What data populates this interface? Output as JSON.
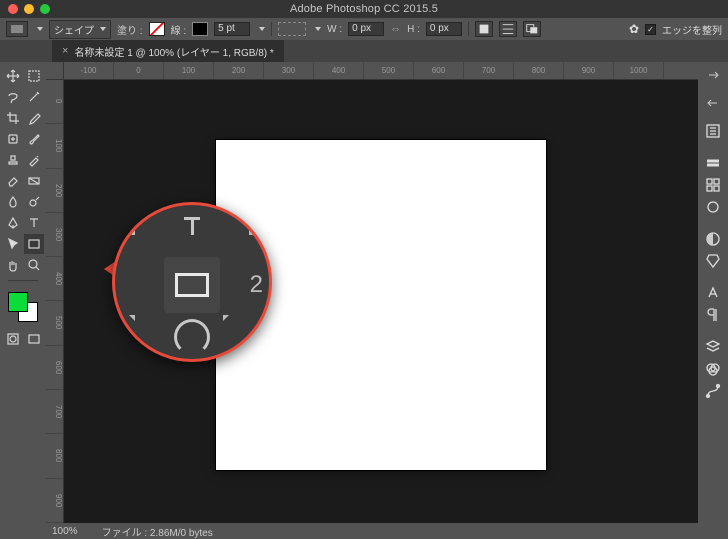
{
  "title_bar": {
    "app_title": "Adobe Photoshop CC 2015.5"
  },
  "options_bar": {
    "mode_label": "シェイプ",
    "fill_label": "塗り :",
    "stroke_label": "線 :",
    "stroke_width": "5 pt",
    "w_label": "W :",
    "w_value": "0 px",
    "h_label": "H :",
    "h_value": "0 px",
    "align_edges_label": "エッジを整列",
    "align_edges_checked": "✓"
  },
  "document_tab": {
    "title": "名称未設定 1 @ 100% (レイヤー 1, RGB/8) *"
  },
  "ruler_h": [
    "-100",
    "0",
    "100",
    "200",
    "300",
    "400",
    "500",
    "600",
    "700",
    "800",
    "900",
    "1000"
  ],
  "ruler_v": [
    "0",
    "100",
    "200",
    "300",
    "400",
    "500",
    "600",
    "700",
    "800",
    "900"
  ],
  "status_bar": {
    "zoom": "100%",
    "file_info": "ファイル : 2.86M/0 bytes"
  },
  "callout": {
    "side_number": "2"
  },
  "colors": {
    "foreground": "#0bdc3a",
    "background": "#ffffff",
    "callout_ring": "#e84a3a"
  }
}
